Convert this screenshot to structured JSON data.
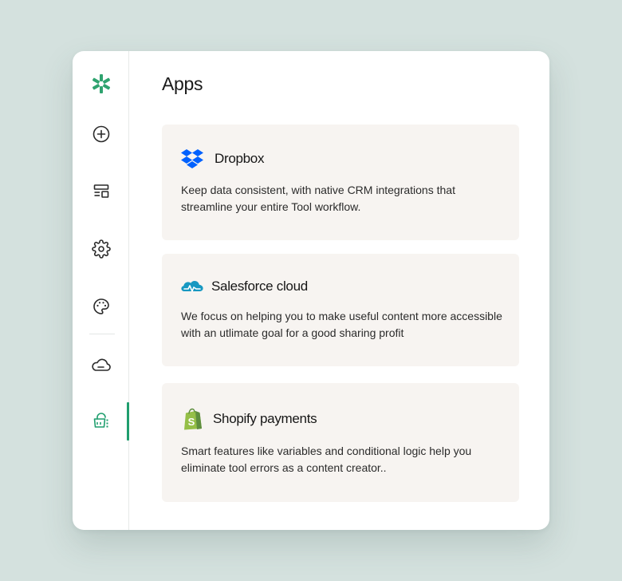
{
  "sidebar": {
    "items": [
      {
        "icon": "logo-asterisk-icon"
      },
      {
        "icon": "plus-circle-icon"
      },
      {
        "icon": "layout-icon"
      },
      {
        "icon": "gear-icon"
      },
      {
        "icon": "palette-icon"
      },
      {
        "icon": "cloud-icon"
      },
      {
        "icon": "apps-basket-icon",
        "active": true
      }
    ],
    "accent": "#1f9e6e"
  },
  "main": {
    "title": "Apps",
    "cards": [
      {
        "name": "Dropbox",
        "icon": "dropbox-icon",
        "description": "Keep data consistent, with native CRM integrations that streamline your entire Tool workflow."
      },
      {
        "name": "Salesforce cloud",
        "icon": "salesforce-icon",
        "description": "We focus on helping you to make useful content more accessible with an utlimate goal for a good sharing profit"
      },
      {
        "name": "Shopify payments",
        "icon": "shopify-icon",
        "description": "Smart features like variables and conditional logic help you eliminate tool errors as a content creator.."
      }
    ]
  },
  "colors": {
    "background": "#d4e1de",
    "card": "#f7f4f1",
    "dropbox": "#0061fe",
    "salesforce": "#1798c1",
    "shopify": "#95bf47"
  }
}
